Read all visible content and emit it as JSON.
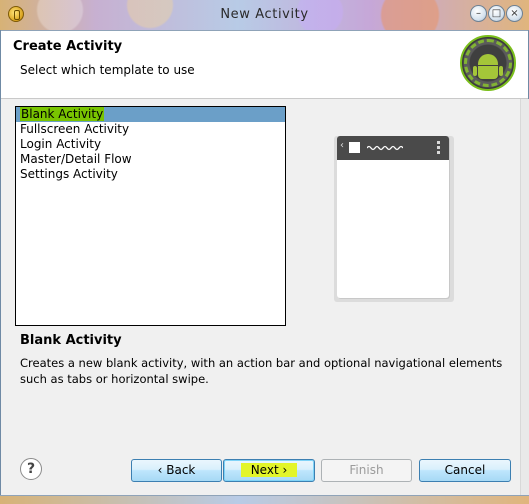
{
  "window": {
    "title": "New Activity"
  },
  "header": {
    "title": "Create Activity",
    "subtitle": "Select which template to use"
  },
  "templates": {
    "items": [
      {
        "label": "Blank Activity",
        "selected": true
      },
      {
        "label": "Fullscreen Activity",
        "selected": false
      },
      {
        "label": "Login Activity",
        "selected": false
      },
      {
        "label": "Master/Detail Flow",
        "selected": false
      },
      {
        "label": "Settings Activity",
        "selected": false
      }
    ]
  },
  "description": {
    "title": "Blank Activity",
    "text": "Creates a new blank activity, with an action bar and optional navigational elements such as tabs or horizontal swipe."
  },
  "buttons": {
    "help": "?",
    "back": "‹ Back",
    "next": "Next ›",
    "finish": "Finish",
    "cancel": "Cancel"
  },
  "icons": {
    "app": "eclipse-icon",
    "logo": "android-logo",
    "help": "help-icon",
    "minimize": "minimize-icon",
    "maximize": "maximize-icon",
    "close": "close-icon"
  },
  "colors": {
    "selection": "#6b9fc8",
    "highlight_green": "#79c400",
    "highlight_yellow": "#e3f52a",
    "android_green": "#a4c639"
  }
}
